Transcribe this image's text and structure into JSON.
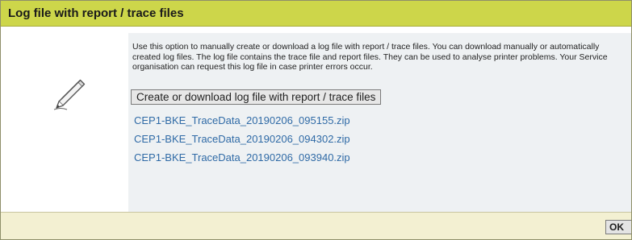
{
  "dialog": {
    "title": "Log file with report / trace files",
    "icon": "pencil-icon"
  },
  "main": {
    "description": "Use this option to manually create or download a log file with report / trace files. You can download manually or automatically created log files. The log file contains the trace file and report files. They can be used to analyse printer problems. Your Service organisation can request this log file in case printer errors occur.",
    "create_button_label": "Create or download log file with report / trace files",
    "files": [
      "CEP1-BKE_TraceData_20190206_095155.zip",
      "CEP1-BKE_TraceData_20190206_094302.zip",
      "CEP1-BKE_TraceData_20190206_093940.zip"
    ]
  },
  "footer": {
    "ok_label": "OK"
  },
  "colors": {
    "title_bar": "#cdd64a",
    "content_bg": "#eef1f3",
    "footer_bg": "#f3f0d2",
    "link": "#2f6aa6"
  }
}
